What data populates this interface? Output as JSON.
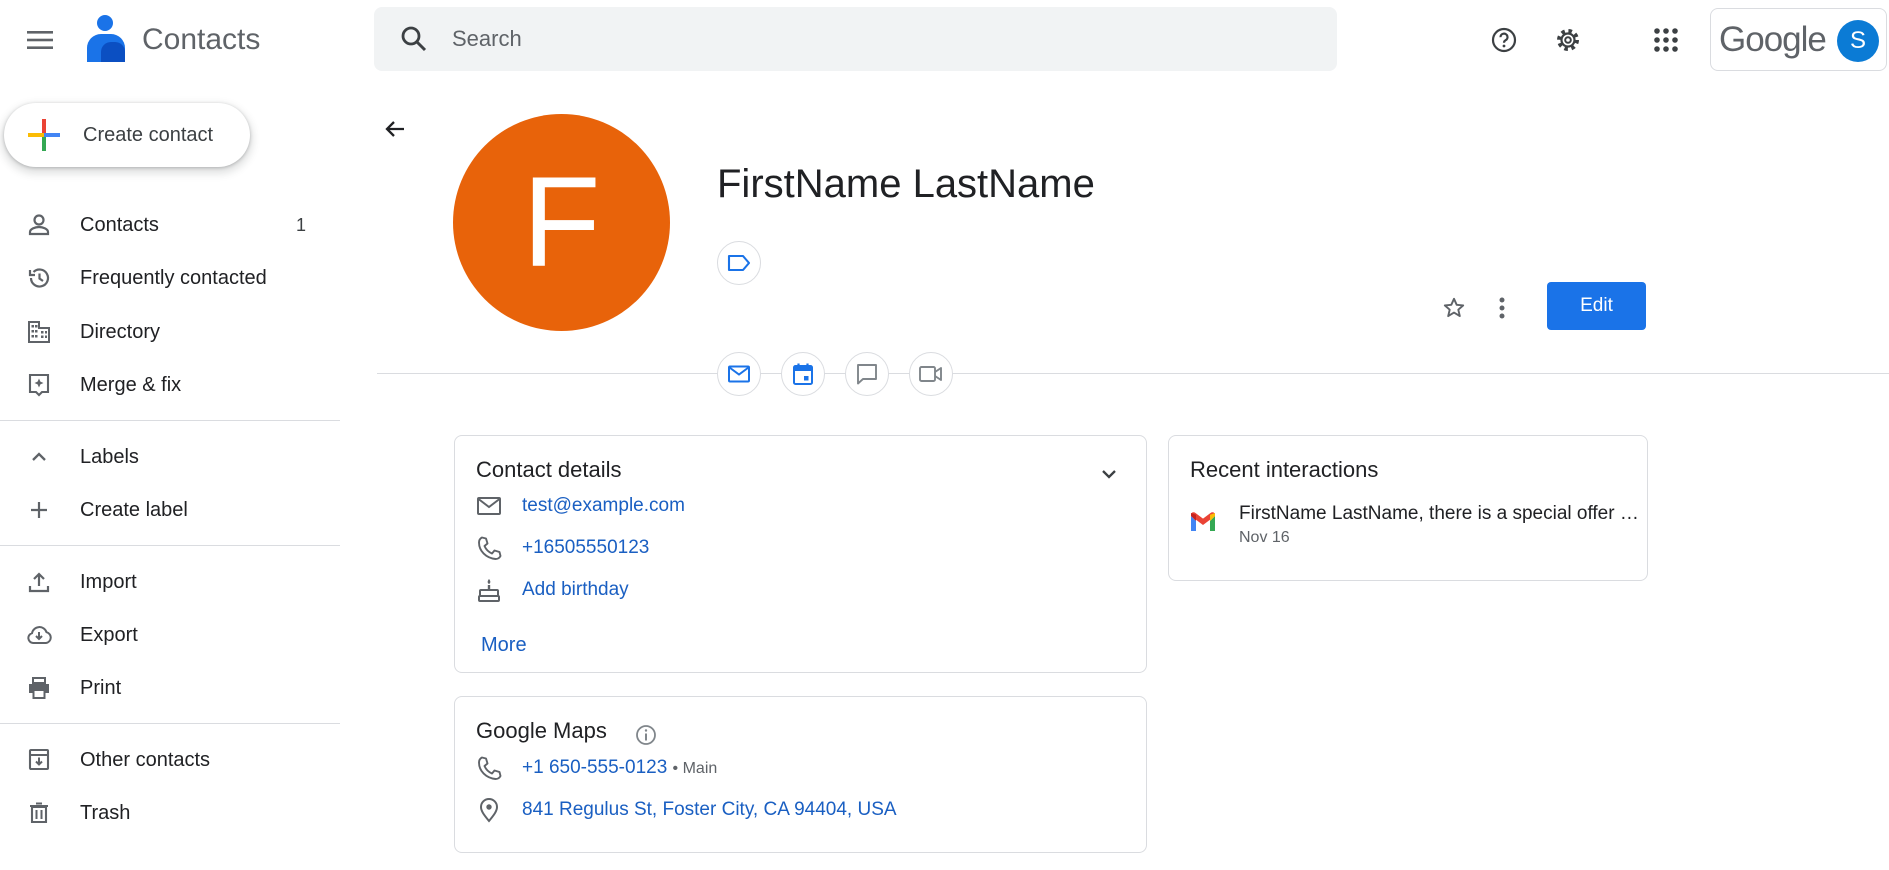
{
  "app": {
    "title": "Contacts"
  },
  "search": {
    "placeholder": "Search"
  },
  "account": {
    "brand": "Google",
    "avatar_letter": "S"
  },
  "sidebar": {
    "create_label": "Create contact",
    "items": [
      {
        "label": "Contacts",
        "count": "1",
        "icon": "person-icon"
      },
      {
        "label": "Frequently contacted",
        "icon": "history-icon"
      },
      {
        "label": "Directory",
        "icon": "domain-icon"
      },
      {
        "label": "Merge & fix",
        "icon": "merge-fix-icon"
      },
      {
        "label": "Labels",
        "icon": "chevron-up-icon"
      },
      {
        "label": "Create label",
        "icon": "plus-icon"
      },
      {
        "label": "Import",
        "icon": "upload-icon"
      },
      {
        "label": "Export",
        "icon": "cloud-download-icon"
      },
      {
        "label": "Print",
        "icon": "print-icon"
      },
      {
        "label": "Other contacts",
        "icon": "archive-icon"
      },
      {
        "label": "Trash",
        "icon": "trash-icon"
      }
    ]
  },
  "contact": {
    "initial": "F",
    "name": "FirstName LastName",
    "avatar_color": "#e8630a",
    "edit_label": "Edit"
  },
  "details": {
    "title": "Contact details",
    "email": "test@example.com",
    "phone": "+16505550123",
    "birthday": "Add birthday",
    "more": "More"
  },
  "maps": {
    "title": "Google Maps",
    "phone": "+1 650-555-0123",
    "phone_type": "• Main",
    "address": "841 Regulus St, Foster City, CA 94404, USA"
  },
  "recent": {
    "title": "Recent interactions",
    "items": [
      {
        "text": "FirstName LastName, there is a special offer for you",
        "date": "Nov 16"
      }
    ]
  },
  "colors": {
    "accent": "#1a73e8",
    "link": "#1a5fc2"
  }
}
